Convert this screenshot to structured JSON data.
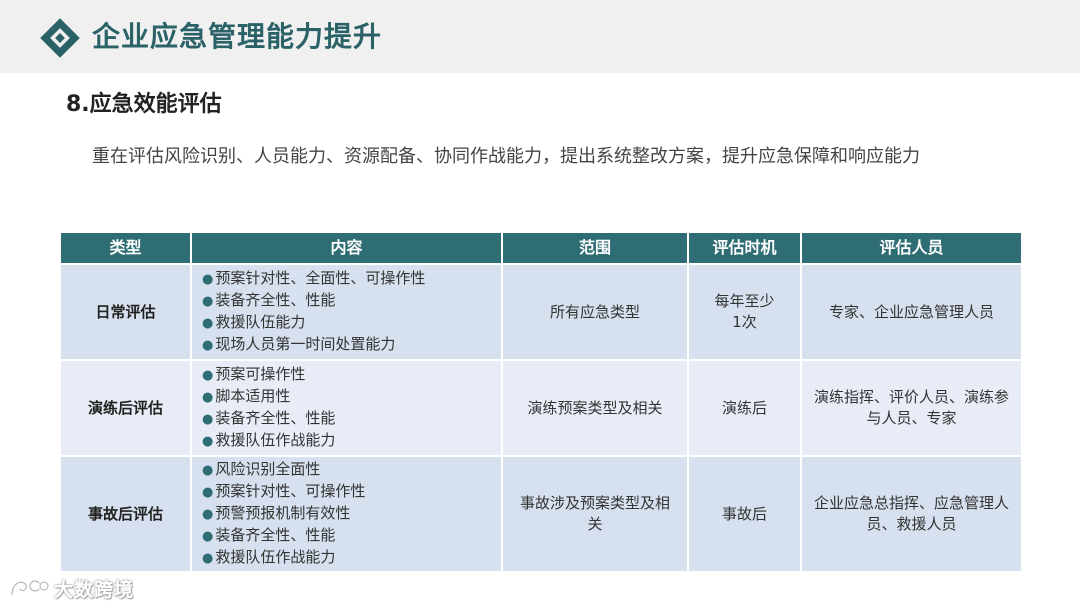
{
  "header": {
    "title": "企业应急管理能力提升",
    "brand_color": "#2b6267"
  },
  "section": {
    "title": "8.应急效能评估",
    "intro": "重在评估风险识别、人员能力、资源配备、协同作战能力，提出系统整改方案，提升应急保障和响应能力"
  },
  "table": {
    "columns": [
      "类型",
      "内容",
      "范围",
      "评估时机",
      "评估人员"
    ],
    "rows": [
      {
        "type": "日常评估",
        "content": [
          "预案针对性、全面性、可操作性",
          "装备齐全性、性能",
          "救援队伍能力",
          "现场人员第一时间处置能力"
        ],
        "scope": "所有应急类型",
        "timing": "每年至少1次",
        "personnel": "专家、企业应急管理人员"
      },
      {
        "type": "演练后评估",
        "content": [
          "预案可操作性",
          "脚本适用性",
          "装备齐全性、性能",
          "救援队伍作战能力"
        ],
        "scope": "演练预案类型及相关",
        "timing": "演练后",
        "personnel": "演练指挥、评价人员、演练参与人员、专家"
      },
      {
        "type": "事故后评估",
        "content": [
          "风险识别全面性",
          "预案针对性、可操作性",
          "预警预报机制有效性",
          "装备齐全性、性能",
          "救援队伍作战能力"
        ],
        "scope": "事故涉及预案类型及相关",
        "timing": "事故后",
        "personnel": "企业应急总指挥、应急管理人员、救援人员"
      }
    ],
    "header_color": "#2e6d74",
    "row_color": "#d6e0ee",
    "row_alt_color": "#e7ecf6"
  },
  "watermark": {
    "text": "大数跨境",
    "icon": "brand-logo-icon"
  }
}
